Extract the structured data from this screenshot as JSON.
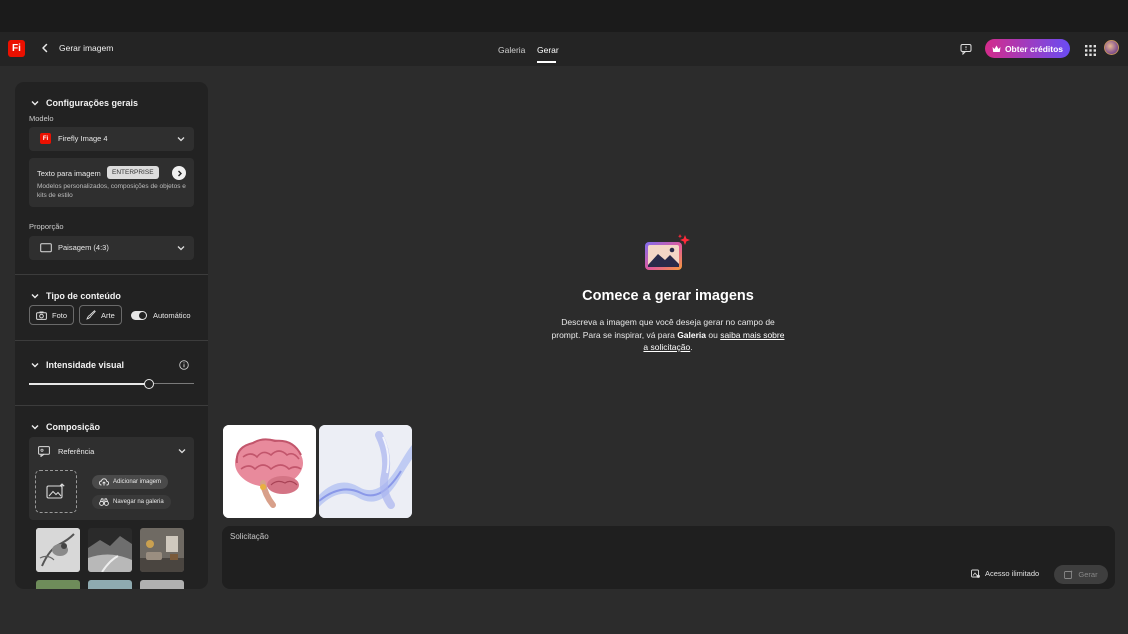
{
  "header": {
    "logo_text": "Fi",
    "back_icon": "chevron-left-icon",
    "title": "Gerar imagem",
    "tabs": [
      {
        "label": "Galeria",
        "active": false
      },
      {
        "label": "Gerar",
        "active": true
      }
    ],
    "credits_label": "Obter créditos",
    "accent_gradient": [
      "#d42c8b",
      "#6a4cf3"
    ]
  },
  "panel": {
    "general": {
      "title": "Configurações gerais",
      "model_label": "Modelo",
      "model_value": "Firefly Image 4",
      "text_to_image": {
        "title": "Texto para imagem",
        "badge": "ENTERPRISE",
        "description": "Modelos personalizados, composições de objetos e kits de estilo"
      },
      "ratio_label": "Proporção",
      "ratio_value": "Paisagem (4:3)"
    },
    "content_type": {
      "title": "Tipo de conteúdo",
      "photo": "Foto",
      "art": "Arte",
      "auto": "Automático",
      "auto_on": true
    },
    "visual_intensity": {
      "title": "Intensidade visual",
      "value_fraction": 0.73
    },
    "composition": {
      "title": "Composição",
      "reference_label": "Referência",
      "add_image": "Adicionar imagem",
      "browse_gallery": "Navegar na galeria"
    }
  },
  "empty_state": {
    "headline": "Comece a gerar imagens",
    "text_1": "Descreva a imagem que você deseja gerar no campo de prompt. Para se inspirar, vá para ",
    "gallery_link": "Galeria",
    "text_2": " ou ",
    "learn_link": "saiba mais sobre a solicitação",
    "text_3": "."
  },
  "prompt": {
    "placeholder": "Solicitação",
    "access": "Acesso ilimitado",
    "generate": "Gerar"
  }
}
